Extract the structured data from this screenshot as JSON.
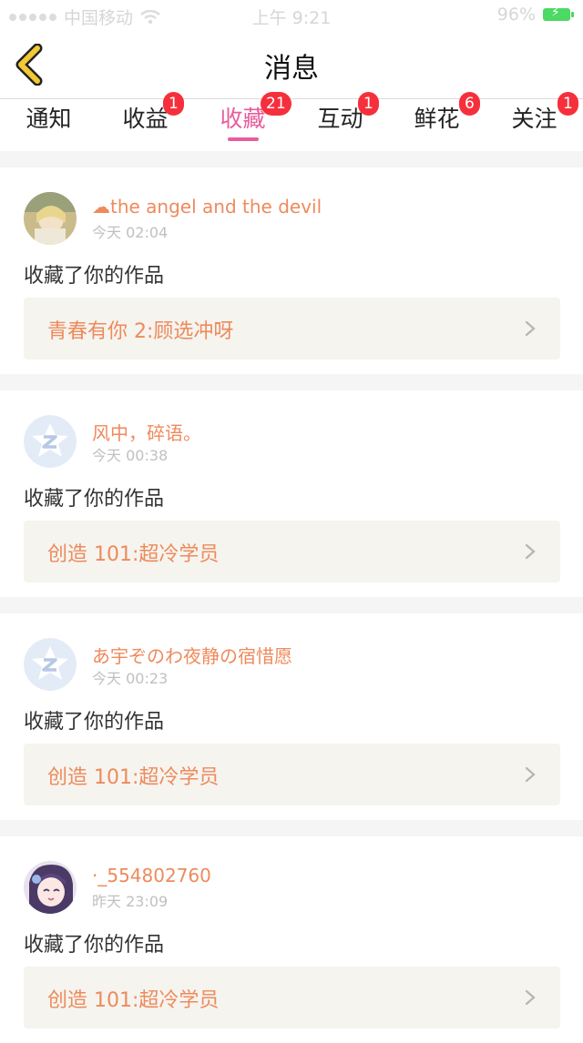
{
  "status_bar": {
    "carrier": "中国移动",
    "time": "上午 9:21",
    "battery": "96%"
  },
  "nav": {
    "title": "消息"
  },
  "tabs": [
    {
      "label": "通知",
      "badge": ""
    },
    {
      "label": "收益",
      "badge": "1"
    },
    {
      "label": "收藏",
      "badge": "21",
      "active": true
    },
    {
      "label": "互动",
      "badge": "1"
    },
    {
      "label": "鲜花",
      "badge": "6"
    },
    {
      "label": "关注",
      "badge": "1"
    }
  ],
  "messages": [
    {
      "user": "☁the angel and the devil",
      "time": "今天 02:04",
      "action": "收藏了你的作品",
      "work": "青春有你 2:顾选冲呀",
      "avatar": "photo-anime"
    },
    {
      "user": "风中，碎语。",
      "time": "今天 00:38",
      "action": "收藏了你的作品",
      "work": "创造 101:超冷学员",
      "avatar": "default-star"
    },
    {
      "user": "あ宇ぞのわ夜静の宿惜愿",
      "time": "今天 00:23",
      "action": "收藏了你的作品",
      "work": "创造 101:超冷学员",
      "avatar": "default-star"
    },
    {
      "user": "·_554802760",
      "time": "昨天 23:09",
      "action": "收藏了你的作品",
      "work": "创造 101:超冷学员",
      "avatar": "anime-girl"
    }
  ],
  "colors": {
    "accent": "#e85d9c",
    "username": "#ee8a5c",
    "badge": "#f5303c",
    "back_arrow": "#f2c935"
  }
}
